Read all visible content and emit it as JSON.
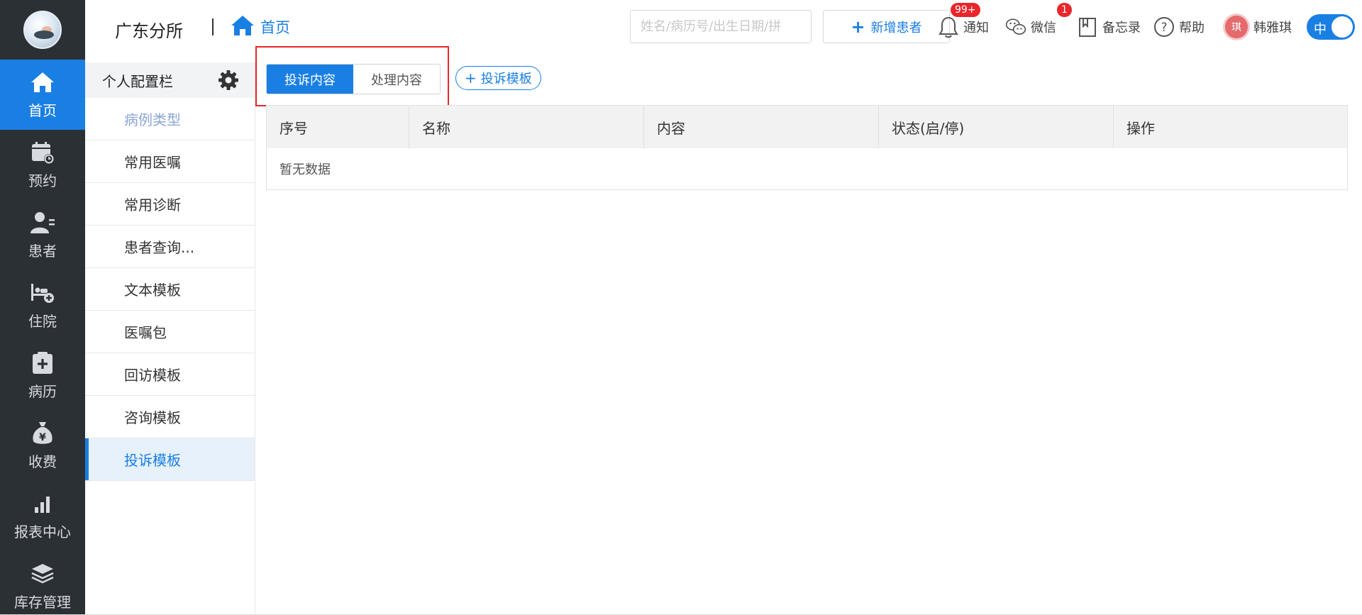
{
  "nav": {
    "items": [
      {
        "label": "首页",
        "icon": "home-icon"
      },
      {
        "label": "预约",
        "icon": "calendar-icon"
      },
      {
        "label": "患者",
        "icon": "patient-icon"
      },
      {
        "label": "住院",
        "icon": "hospital-bed-icon"
      },
      {
        "label": "病历",
        "icon": "medical-record-icon"
      },
      {
        "label": "收费",
        "icon": "money-bag-icon"
      },
      {
        "label": "报表中心",
        "icon": "bar-chart-icon"
      },
      {
        "label": "库存管理",
        "icon": "layers-icon"
      }
    ],
    "active_index": 0
  },
  "header": {
    "clinic_name": "广东分所",
    "breadcrumb_home": "首页",
    "search_placeholder": "姓名/病历号/出生日期/拼",
    "add_patient_label": "新增患者",
    "notify_label": "通知",
    "notify_badge": "99+",
    "wechat_label": "微信",
    "wechat_badge": "1",
    "memo_label": "备忘录",
    "help_label": "帮助",
    "user_avatar_char": "琪",
    "user_name": "韩雅琪",
    "lang_toggle_label": "中"
  },
  "config": {
    "title": "个人配置栏",
    "items": [
      {
        "label": "病例类型",
        "state": "disabled"
      },
      {
        "label": "常用医嘱",
        "state": "normal"
      },
      {
        "label": "常用诊断",
        "state": "normal"
      },
      {
        "label": "患者查询...",
        "state": "normal"
      },
      {
        "label": "文本模板",
        "state": "normal"
      },
      {
        "label": "医嘱包",
        "state": "normal"
      },
      {
        "label": "回访模板",
        "state": "normal"
      },
      {
        "label": "咨询模板",
        "state": "normal"
      },
      {
        "label": "投诉模板",
        "state": "active"
      }
    ]
  },
  "main": {
    "tabs": [
      {
        "label": "投诉内容",
        "selected": true
      },
      {
        "label": "处理内容",
        "selected": false
      }
    ],
    "template_button_label": "投诉模板",
    "table": {
      "columns": [
        "序号",
        "名称",
        "内容",
        "状态(启/停)",
        "操作"
      ],
      "rows": [],
      "empty_text": "暂无数据"
    }
  },
  "colors": {
    "accent": "#1a7fe2",
    "nav_bg": "#2b3035",
    "highlight": "#e8262b",
    "badge": "#e8262b"
  }
}
